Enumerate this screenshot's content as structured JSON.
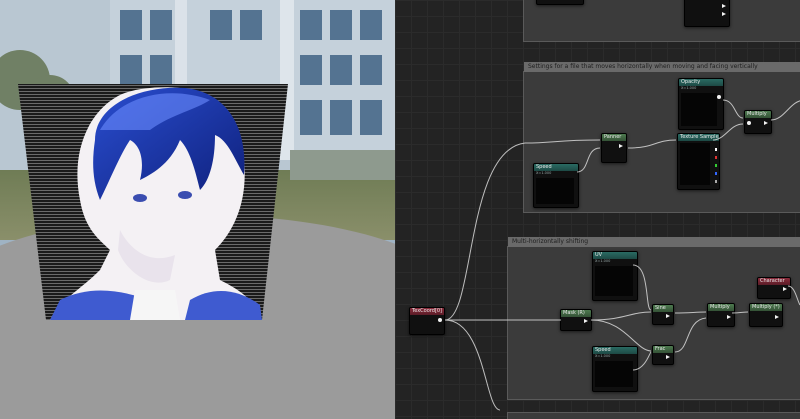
{
  "graph": {
    "comments": [
      {
        "title": "Settings for a file that moves horizontally when moving and facing vertically"
      },
      {
        "title": "Multi-horizontally shifting"
      }
    ],
    "nodes": {
      "speed_top": {
        "label": "Speed",
        "sub": "X=1.000"
      },
      "speed_mid": {
        "label": "Speed",
        "sub": "X=1.000"
      },
      "opacity": {
        "label": "Opacity",
        "sub": "X=1.000"
      },
      "texture_sample": {
        "label": "Texture Sample",
        "sub": "Tex"
      },
      "panner_top": {
        "label": "Panner",
        "sub": "Coordinate"
      },
      "multiply_top": {
        "label": "Multiply",
        "sub": "A B"
      },
      "texcoord": {
        "label": "TexCoord[0]",
        "sub": ""
      },
      "uv": {
        "label": "UV",
        "sub": "X=1.000"
      },
      "mask": {
        "label": "Mask (R)",
        "sub": ""
      },
      "sine": {
        "label": "Sine",
        "sub": ""
      },
      "frac": {
        "label": "Frac",
        "sub": ""
      },
      "multiply_b1": {
        "label": "Multiply",
        "sub": ""
      },
      "multiply_b2": {
        "label": "Multiply (*)",
        "sub": ""
      },
      "character": {
        "label": "Character",
        "sub": ""
      },
      "speed_bottom": {
        "label": "Speed",
        "sub": "X=1.000"
      }
    }
  }
}
